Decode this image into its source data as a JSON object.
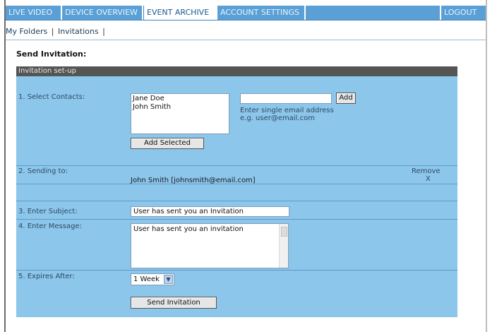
{
  "nav": {
    "tabs": [
      {
        "label": "LIVE VIDEO",
        "active": false
      },
      {
        "label": "DEVICE OVERVIEW",
        "active": false
      },
      {
        "label": "EVENT ARCHIVE",
        "active": true
      },
      {
        "label": "ACCOUNT SETTINGS",
        "active": false
      }
    ],
    "logout": "LOGOUT"
  },
  "subnav": {
    "items": [
      "My Folders",
      "Invitations"
    ],
    "separator": "|"
  },
  "page": {
    "title": "Send Invitation:"
  },
  "panel": {
    "header": "Invitation set-up",
    "contacts": {
      "label": "1.  Select Contacts:",
      "list": [
        "Jane Doe",
        "John Smith"
      ],
      "add_selected": "Add Selected",
      "email_input_value": "",
      "email_placeholder": "",
      "add_button": "Add",
      "hint_line1": "Enter single email address",
      "hint_line2": "e.g. user@email.com"
    },
    "sending": {
      "label": "2.  Sending to:",
      "recipient": "John Smith  [johnsmith@email.com]",
      "remove_label": "Remove",
      "remove_x": "X"
    },
    "subject": {
      "label": "3.  Enter Subject:",
      "value": "User has sent you an Invitation"
    },
    "message": {
      "label": "4.  Enter Message:",
      "value": "User has sent you an invitation"
    },
    "expires": {
      "label": "5.  Expires After:",
      "value": "1 Week"
    },
    "send_button": "Send Invitation"
  },
  "colors": {
    "nav_bar": "#5aa0d6",
    "panel_background": "#8cc6eb",
    "panel_header": "#555555"
  }
}
